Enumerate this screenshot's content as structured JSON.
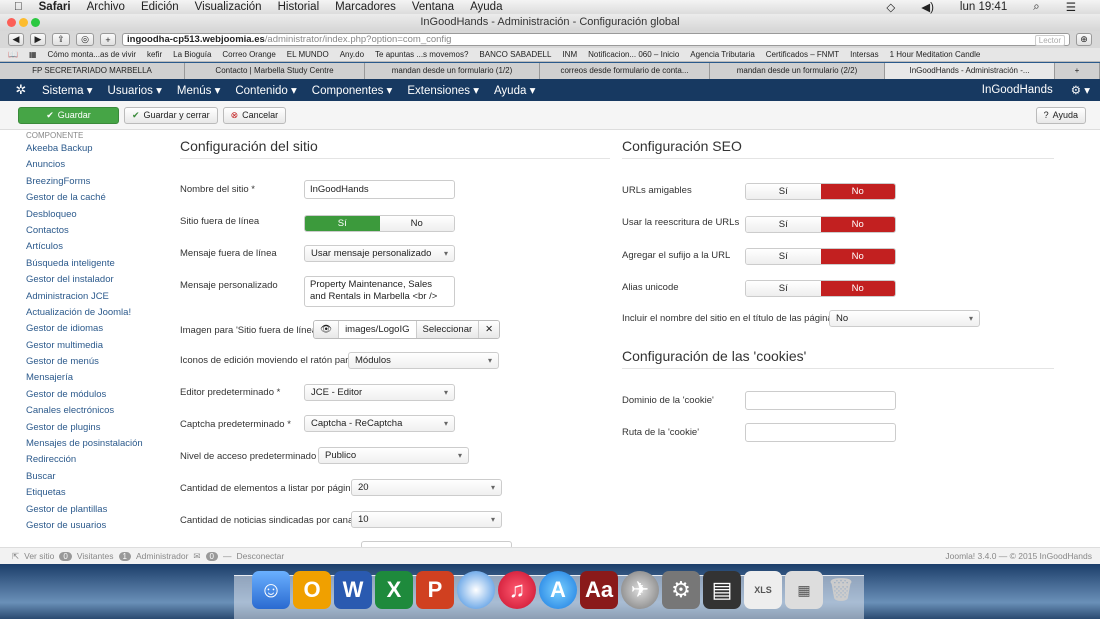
{
  "mac_menubar": {
    "app": "Safari",
    "items": [
      "Archivo",
      "Edición",
      "Visualización",
      "Historial",
      "Marcadores",
      "Ventana",
      "Ayuda"
    ],
    "clock": "lun 19:41"
  },
  "window": {
    "title": "InGoodHands - Administración - Configuración global"
  },
  "browser": {
    "url_host": "ingoodha-cp513.webjoomia.es",
    "url_path": "/administrator/index.php?option=com_config",
    "reader": "Lector",
    "bookmarks": [
      "Cómo monta...as de vivir",
      "kefir",
      "La Bioguía",
      "Correo Orange",
      "EL MUNDO",
      "Any.do",
      "Te apuntas ...s movemos?",
      "BANCO SABADELL",
      "INM",
      "Notificacion... 060 – Inicio",
      "Agencia Tributaria",
      "Certificados – FNMT",
      "Intersas",
      "1 Hour Meditation Candle"
    ],
    "tabs": [
      "FP SECRETARIADO MARBELLA",
      "Contacto | Marbella Study Centre",
      "mandan desde un formulario (1/2)",
      "correos desde formulario de conta...",
      "mandan desde un formulario (2/2)",
      "InGoodHands - Administración -..."
    ]
  },
  "joomla_nav": {
    "items": [
      "Sistema ▾",
      "Usuarios ▾",
      "Menús ▾",
      "Contenido ▾",
      "Componentes ▾",
      "Extensiones ▾",
      "Ayuda ▾"
    ],
    "site": "InGoodHands"
  },
  "actions": {
    "save": "Guardar",
    "save_close": "Guardar y cerrar",
    "cancel": "Cancelar",
    "help": "Ayuda"
  },
  "sidebar": {
    "header": "COMPONENTE",
    "items": [
      "Akeeba Backup",
      "Anuncios",
      "BreezingForms",
      "Gestor de la caché",
      "Desbloqueo",
      "Contactos",
      "Artículos",
      "Búsqueda inteligente",
      "Gestor del instalador",
      "Administracion JCE",
      "Actualización de Joomla!",
      "Gestor de idiomas",
      "Gestor multimedia",
      "Gestor de menús",
      "Mensajería",
      "Gestor de módulos",
      "Canales electrónicos",
      "Gestor de plugins",
      "Mensajes de posinstalación",
      "Redirección",
      "Buscar",
      "Etiquetas",
      "Gestor de plantillas",
      "Gestor de usuarios"
    ]
  },
  "site_config": {
    "title": "Configuración del sitio",
    "site_name_label": "Nombre del sitio *",
    "site_name_value": "InGoodHands",
    "offline_label": "Sitio fuera de línea",
    "yes": "Sí",
    "no": "No",
    "offline_msg_label": "Mensaje fuera de línea",
    "offline_msg_value": "Usar mensaje personalizado",
    "custom_msg_label": "Mensaje personalizado",
    "custom_msg_value": "Property Maintenance, Sales and Rentals in Marbella <br />",
    "offline_image_label": "Imagen para 'Sitio fuera de línea'",
    "offline_image_value": "images/LogoIG",
    "select": "Seleccionar",
    "edit_icons_label": "Iconos de edición moviendo el ratón para",
    "edit_icons_value": "Módulos",
    "editor_label": "Editor predeterminado *",
    "editor_value": "JCE - Editor",
    "captcha_label": "Captcha predeterminado *",
    "captcha_value": "Captcha - ReCaptcha",
    "access_label": "Nivel de acceso predeterminado *",
    "access_value": "Publico",
    "list_limit_label": "Cantidad de elementos a listar por página",
    "list_limit_value": "20",
    "feed_limit_label": "Cantidad de noticias sindicadas por canal",
    "feed_limit_value": "10"
  },
  "seo": {
    "title": "Configuración SEO",
    "sef_label": "URLs amigables",
    "rewrite_label": "Usar la reescritura de URLs",
    "suffix_label": "Agregar el sufijo a la URL",
    "unicode_label": "Alias unicode",
    "sitename_pages_label": "Incluir el nombre del sitio en el título de las páginas",
    "sitename_pages_value": "No"
  },
  "cookies": {
    "title": "Configuración de las 'cookies'",
    "domain_label": "Dominio de la 'cookie'",
    "path_label": "Ruta de la 'cookie'"
  },
  "status": {
    "view_site": "Ver sitio",
    "visitors_count": "0",
    "visitors": "Visitantes",
    "admins_count": "1",
    "admins": "Administrador",
    "msgs_count": "0",
    "logout": "Desconectar",
    "version": "Joomla! 3.4.0  —  © 2015 InGoodHands"
  },
  "colors": {
    "joomla_nav": "#173961",
    "save_green": "#46a546",
    "toggle_red": "#c22020",
    "link_blue": "#2c5a8c"
  }
}
